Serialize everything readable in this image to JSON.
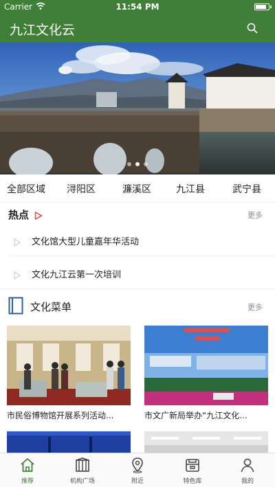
{
  "status_bar": {
    "carrier": "Carrier",
    "time": "11:54 PM",
    "battery_level": 0.85
  },
  "nav": {
    "title": "九江文化云",
    "search_icon": "search-icon"
  },
  "banner": {
    "slide_count": 3,
    "active_slide": 2
  },
  "regions": [
    "全部区域",
    "浔阳区",
    "濂溪区",
    "九江县",
    "武宁县"
  ],
  "hot": {
    "title": "热点",
    "more": "更多",
    "items": [
      "文化馆大型儿童嘉年华活动",
      "文化九江云第一次培训"
    ]
  },
  "culture_menu": {
    "title": "文化菜单",
    "more": "更多",
    "cards": [
      {
        "caption": "市民俗博物馆开展系列活动..."
      },
      {
        "caption": "市文广新局举办“九江文化..."
      }
    ]
  },
  "tabs": [
    {
      "label": "推荐",
      "icon": "home-icon",
      "active": true
    },
    {
      "label": "机构广场",
      "icon": "building-icon",
      "active": false
    },
    {
      "label": "附近",
      "icon": "location-pin-icon",
      "active": false
    },
    {
      "label": "特色库",
      "icon": "archive-box-icon",
      "active": false
    },
    {
      "label": "我的",
      "icon": "person-icon",
      "active": false
    }
  ],
  "colors": {
    "primary": "#3f7f37",
    "hot_arrow": "#e2453c",
    "menu_icon": "#2b5ea8"
  }
}
